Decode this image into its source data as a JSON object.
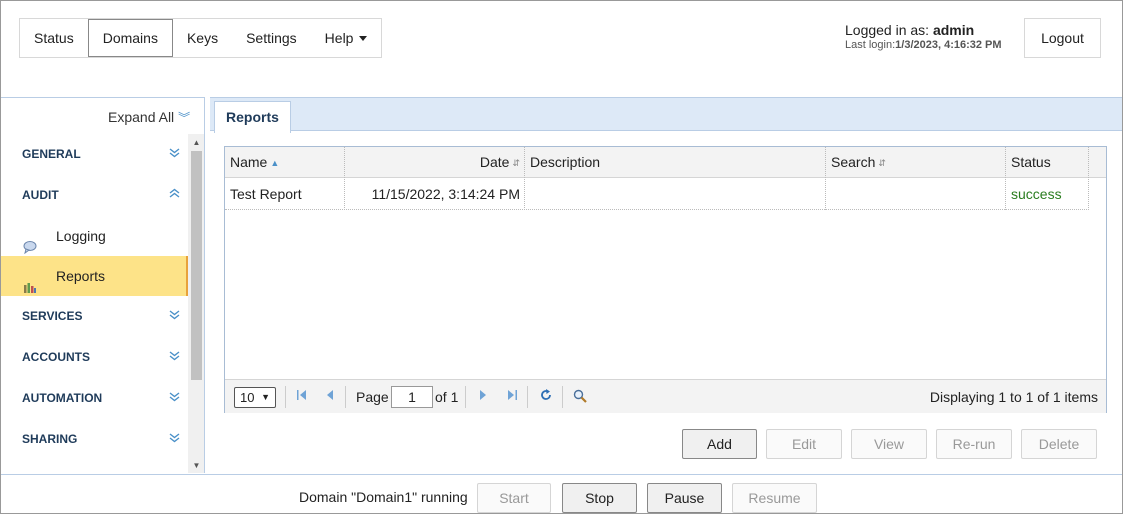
{
  "nav": {
    "items": [
      {
        "label": "Status"
      },
      {
        "label": "Domains"
      },
      {
        "label": "Keys"
      },
      {
        "label": "Settings"
      },
      {
        "label": "Help"
      }
    ]
  },
  "user": {
    "logged_in_prefix": "Logged in as: ",
    "username": "admin",
    "last_login_prefix": "Last login:",
    "last_login": "1/3/2023, 4:16:32 PM",
    "logout_label": "Logout"
  },
  "sidebar": {
    "expand_all_label": "Expand All",
    "sections": [
      {
        "label": "GENERAL"
      },
      {
        "label": "AUDIT"
      },
      {
        "label": "SERVICES"
      },
      {
        "label": "ACCOUNTS"
      },
      {
        "label": "AUTOMATION"
      },
      {
        "label": "SHARING"
      }
    ],
    "audit_items": [
      {
        "label": "Logging",
        "icon": "speech-bubble-icon"
      },
      {
        "label": "Reports",
        "icon": "bar-chart-icon"
      }
    ]
  },
  "main": {
    "tab_label": "Reports",
    "table": {
      "columns": [
        "Name",
        "Date",
        "Description",
        "Search",
        "Status"
      ],
      "rows": [
        {
          "name": "Test Report",
          "date": "11/15/2022, 3:14:24 PM",
          "description": "",
          "search": "",
          "status": "success"
        }
      ]
    },
    "pager": {
      "page_size": "10",
      "page_label": "Page",
      "page_value": "1",
      "of_label": "of 1",
      "display_text": "Displaying 1 to 1 of 1 items"
    },
    "actions": {
      "add": "Add",
      "edit": "Edit",
      "view": "View",
      "rerun": "Re-run",
      "delete": "Delete"
    }
  },
  "footer": {
    "status_text": "Domain \"Domain1\" running",
    "start": "Start",
    "stop": "Stop",
    "pause": "Pause",
    "resume": "Resume"
  },
  "colors": {
    "accent": "#4a90c8",
    "active_nav_bg": "#fde388",
    "active_nav_border": "#e8a23b",
    "tabbar_bg": "#dde9f7",
    "status_success": "#2a7d1f"
  }
}
